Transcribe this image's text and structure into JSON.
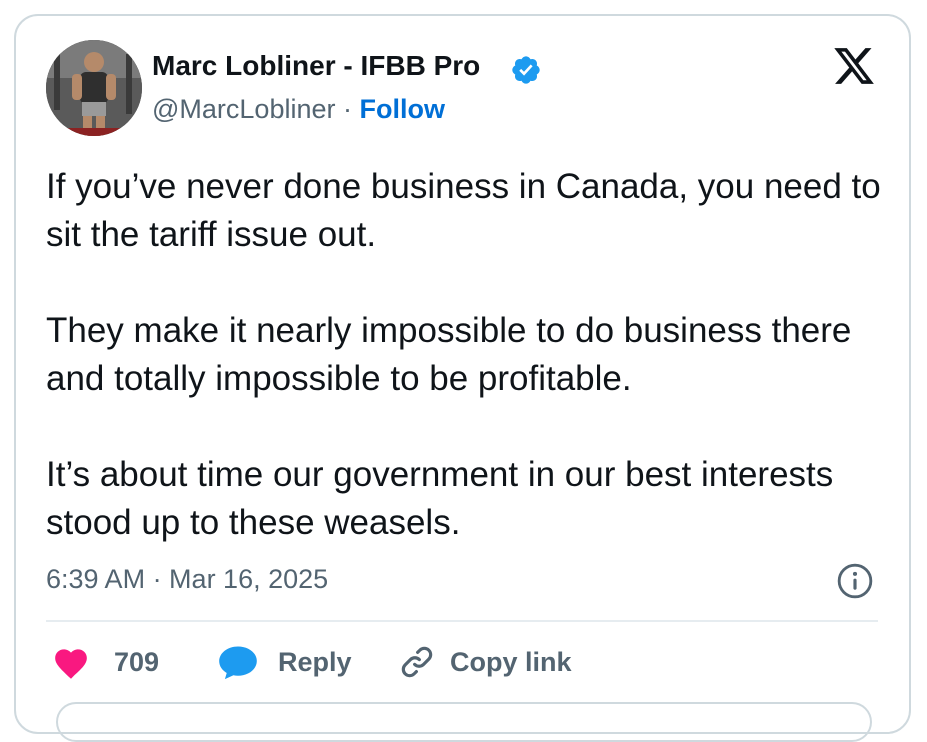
{
  "author": {
    "name": "Marc Lobliner - IFBB Pro",
    "handle": "@MarcLobliner",
    "separator": "·",
    "follow_label": "Follow"
  },
  "tweet": {
    "paragraphs": [
      "If you’ve never done business in Canada, you need to sit the tariff issue out.",
      "They make it nearly impossible to do business there and totally impossible to be profitable.",
      "It’s about time our government in our best interests stood up to these weasels."
    ],
    "timestamp": "6:39 AM · Mar 16, 2025"
  },
  "actions": {
    "like_count": "709",
    "reply_label": "Reply",
    "copy_label": "Copy link"
  },
  "icons": {
    "verified": "verified-badge-icon",
    "x_logo": "x-logo-icon",
    "info": "info-icon",
    "heart": "heart-icon",
    "reply": "speech-bubble-icon",
    "link": "link-icon"
  },
  "colors": {
    "verified_blue": "#1d9bf0",
    "follow_blue": "#006fd6",
    "heart_pink": "#f91880",
    "reply_blue": "#1d9bf0",
    "muted_gray": "#536471",
    "text_black": "#0f1419"
  }
}
